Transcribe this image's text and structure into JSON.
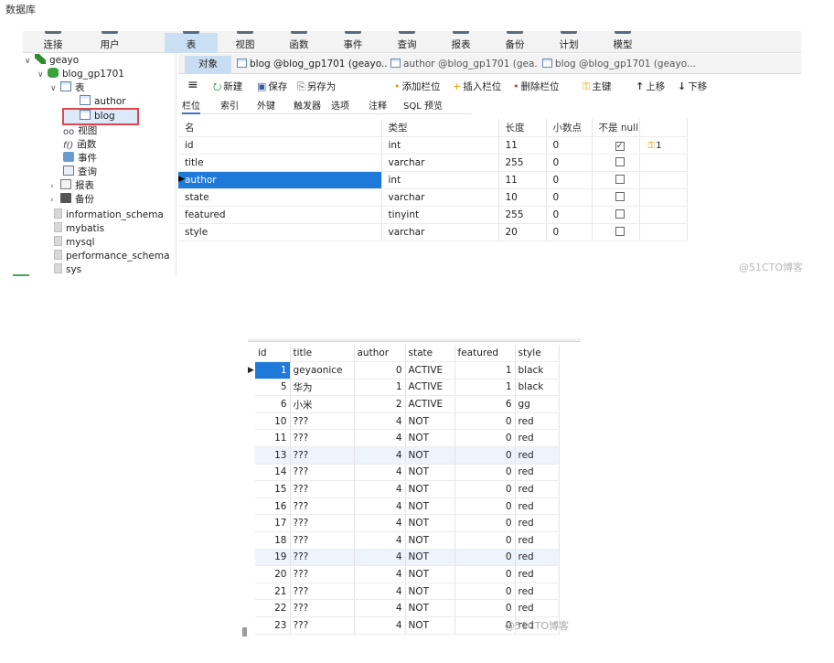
{
  "caption": "数据库",
  "top": {
    "toolbar": [
      "连接",
      "用户",
      "表",
      "视图",
      "函数",
      "事件",
      "查询",
      "报表",
      "备份",
      "计划",
      "模型"
    ],
    "toolbar_active": "表",
    "tree": {
      "connection": "geayo",
      "database": "blog_gp1701",
      "tables_label": "表",
      "tables": [
        "author",
        "blog"
      ],
      "selected_table": "blog",
      "nodes": [
        "视图",
        "函数",
        "事件",
        "查询",
        "报表",
        "备份"
      ],
      "other_dbs": [
        "information_schema",
        "mybatis",
        "mysql",
        "performance_schema",
        "sys"
      ]
    },
    "tabs": {
      "object": "对象",
      "docs": [
        "blog @blog_gp1701 (geayo...",
        "author @blog_gp1701 (gea...",
        "blog @blog_gp1701 (geayo..."
      ]
    },
    "designer_toolbar": {
      "menu": "≡",
      "new": "新建",
      "save": "保存",
      "save_as": "另存为",
      "add_field": "添加栏位",
      "insert_field": "插入栏位",
      "delete_field": "删除栏位",
      "primary_key": "主键",
      "move_up": "上移",
      "move_down": "下移"
    },
    "subtabs": [
      "栏位",
      "索引",
      "外键",
      "触发器",
      "选项",
      "注释",
      "SQL 预览"
    ],
    "columns_header": [
      "名",
      "类型",
      "长度",
      "小数点",
      "不是 null",
      ""
    ],
    "fields": [
      {
        "name": "id",
        "type": "int",
        "length": "11",
        "decimals": "0",
        "not_null": true,
        "key": "1"
      },
      {
        "name": "title",
        "type": "varchar",
        "length": "255",
        "decimals": "0",
        "not_null": false,
        "key": ""
      },
      {
        "name": "author",
        "type": "int",
        "length": "11",
        "decimals": "0",
        "not_null": false,
        "key": ""
      },
      {
        "name": "state",
        "type": "varchar",
        "length": "10",
        "decimals": "0",
        "not_null": false,
        "key": ""
      },
      {
        "name": "featured",
        "type": "tinyint",
        "length": "255",
        "decimals": "0",
        "not_null": false,
        "key": ""
      },
      {
        "name": "style",
        "type": "varchar",
        "length": "20",
        "decimals": "0",
        "not_null": false,
        "key": ""
      }
    ],
    "selected_field": "author",
    "watermark": "@51CTO博客"
  },
  "bottom": {
    "columns": [
      "id",
      "title",
      "author",
      "state",
      "featured",
      "style"
    ],
    "rows": [
      [
        "1",
        "geyaonice",
        "0",
        "ACTIVE",
        "1",
        "black"
      ],
      [
        "5",
        "华为",
        "1",
        "ACTIVE",
        "1",
        "black"
      ],
      [
        "6",
        "小米",
        "2",
        "ACTIVE",
        "6",
        "gg"
      ],
      [
        "10",
        "???",
        "4",
        "NOT",
        "0",
        "red"
      ],
      [
        "11",
        "???",
        "4",
        "NOT",
        "0",
        "red"
      ],
      [
        "13",
        "???",
        "4",
        "NOT",
        "0",
        "red"
      ],
      [
        "14",
        "???",
        "4",
        "NOT",
        "0",
        "red"
      ],
      [
        "15",
        "???",
        "4",
        "NOT",
        "0",
        "red"
      ],
      [
        "16",
        "???",
        "4",
        "NOT",
        "0",
        "red"
      ],
      [
        "17",
        "???",
        "4",
        "NOT",
        "0",
        "red"
      ],
      [
        "18",
        "???",
        "4",
        "NOT",
        "0",
        "red"
      ],
      [
        "19",
        "???",
        "4",
        "NOT",
        "0",
        "red"
      ],
      [
        "20",
        "???",
        "4",
        "NOT",
        "0",
        "red"
      ],
      [
        "21",
        "???",
        "4",
        "NOT",
        "0",
        "red"
      ],
      [
        "22",
        "???",
        "4",
        "NOT",
        "0",
        "red"
      ],
      [
        "23",
        "???",
        "4",
        "NOT",
        "0",
        "red"
      ]
    ],
    "watermark": "@51CTO博客"
  }
}
